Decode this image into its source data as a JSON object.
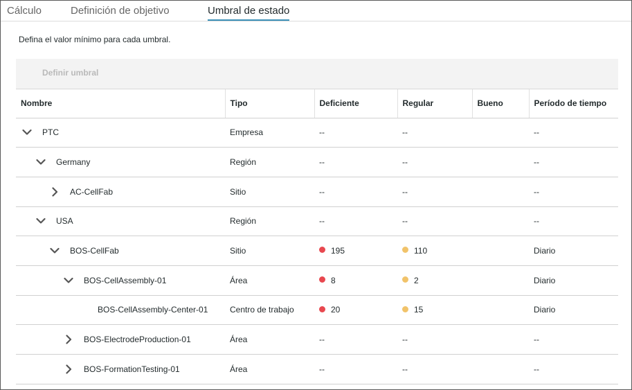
{
  "tabs": [
    {
      "label": "Cálculo",
      "active": false
    },
    {
      "label": "Definición de objetivo",
      "active": false
    },
    {
      "label": "Umbral de estado",
      "active": true
    }
  ],
  "instruction": "Defina el valor mínimo para cada umbral.",
  "toolbar": {
    "define_label": "Definir umbral"
  },
  "columns": [
    "Nombre",
    "Tipo",
    "Deficiente",
    "Regular",
    "Bueno",
    "Período de tiempo"
  ],
  "colors": {
    "deficiente": "#e8484f",
    "regular": "#f1c36a",
    "accent": "#3a8fb7"
  },
  "rows": [
    {
      "name": "PTC",
      "level": 0,
      "toggle": "expanded",
      "type": "Empresa",
      "deficiente": "--",
      "regular": "--",
      "bueno": "",
      "period": "--"
    },
    {
      "name": "Germany",
      "level": 1,
      "toggle": "expanded",
      "type": "Región",
      "deficiente": "--",
      "regular": "--",
      "bueno": "",
      "period": "--"
    },
    {
      "name": "AC-CellFab",
      "level": 2,
      "toggle": "collapsed",
      "type": "Sitio",
      "deficiente": "--",
      "regular": "--",
      "bueno": "",
      "period": "--"
    },
    {
      "name": "USA",
      "level": 1,
      "toggle": "expanded",
      "type": "Región",
      "deficiente": "--",
      "regular": "--",
      "bueno": "",
      "period": "--"
    },
    {
      "name": "BOS-CellFab",
      "level": 2,
      "toggle": "expanded",
      "type": "Sitio",
      "deficiente": "195",
      "regular": "110",
      "bueno": "",
      "period": "Diario"
    },
    {
      "name": "BOS-CellAssembly-01",
      "level": 3,
      "toggle": "expanded",
      "type": "Área",
      "deficiente": "8",
      "regular": "2",
      "bueno": "",
      "period": "Diario"
    },
    {
      "name": "BOS-CellAssembly-Center-01",
      "level": 4,
      "toggle": "none",
      "type": "Centro de trabajo",
      "deficiente": "20",
      "regular": "15",
      "bueno": "",
      "period": "Diario"
    },
    {
      "name": "BOS-ElectrodeProduction-01",
      "level": 3,
      "toggle": "collapsed",
      "type": "Área",
      "deficiente": "--",
      "regular": "--",
      "bueno": "",
      "period": "--"
    },
    {
      "name": "BOS-FormationTesting-01",
      "level": 3,
      "toggle": "collapsed",
      "type": "Área",
      "deficiente": "--",
      "regular": "--",
      "bueno": "",
      "period": "--"
    }
  ]
}
